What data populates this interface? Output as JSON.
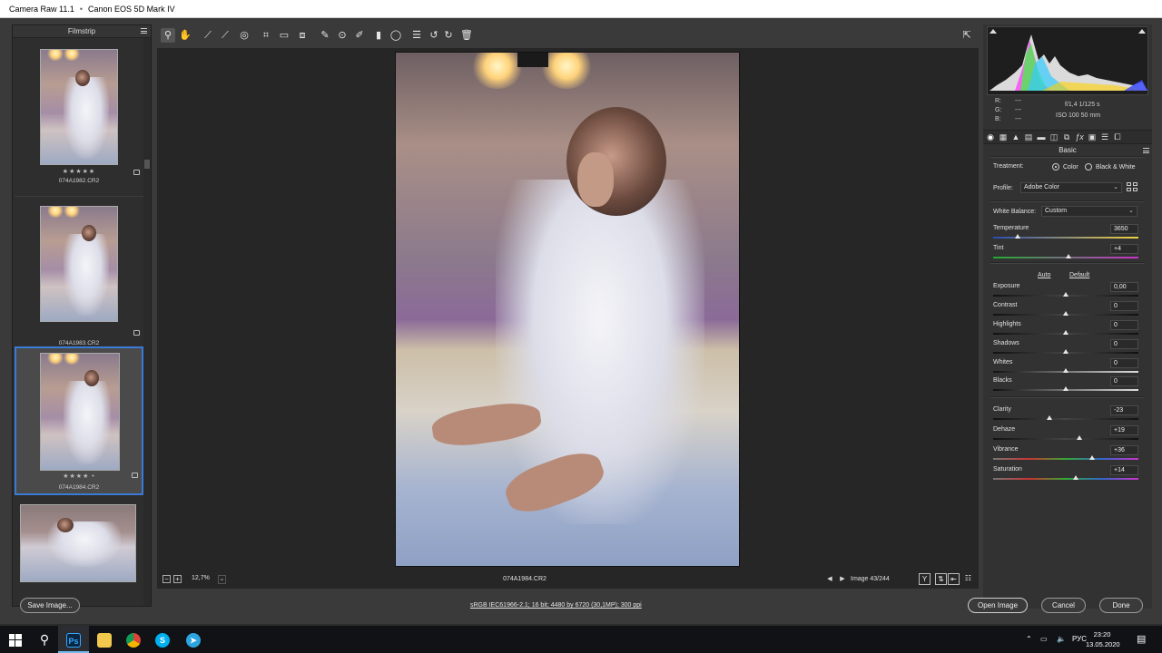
{
  "window": {
    "app_title": "Camera Raw 11.1",
    "camera": "Canon EOS 5D Mark IV"
  },
  "filmstrip": {
    "title": "Filmstrip",
    "items": [
      {
        "filename": "074A1982.CR2",
        "stars": "★★★★★"
      },
      {
        "filename": "074A1983.CR2",
        "stars": ""
      },
      {
        "filename": "074A1984.CR2",
        "stars": "★★★★ •"
      },
      {
        "filename": "",
        "stars": ""
      }
    ]
  },
  "toolbar": {
    "tools": [
      "zoom-tool-icon",
      "hand-tool-icon",
      "white-balance-tool-icon",
      "color-sampler-tool-icon",
      "targeted-adjustment-tool-icon",
      "crop-tool-icon",
      "straighten-tool-icon",
      "transform-tool-icon",
      "spot-removal-tool-icon",
      "red-eye-tool-icon",
      "adjustment-brush-icon",
      "graduated-filter-icon",
      "radial-filter-icon",
      "preferences-icon",
      "rotate-ccw-icon",
      "rotate-cw-icon",
      "trash-icon"
    ]
  },
  "canvas": {
    "zoom": "12,7%",
    "current_file": "074A1984.CR2",
    "image_count": "Image 43/244"
  },
  "histogram": {
    "rgb_labels": [
      "R:",
      "G:",
      "B:"
    ],
    "rgb_values": [
      "---",
      "---",
      "---"
    ],
    "aperture_shutter": "f/1,4   1/125 s",
    "iso_focal": "ISO 100   50 mm"
  },
  "basic": {
    "title": "Basic",
    "treatment_label": "Treatment:",
    "treatment_color": "Color",
    "treatment_bw": "Black & White",
    "profile_label": "Profile:",
    "profile_value": "Adobe Color",
    "wb_label": "White Balance:",
    "wb_value": "Custom",
    "auto_label": "Auto",
    "default_label": "Default",
    "sliders": {
      "temperature": {
        "label": "Temperature",
        "value": "3650",
        "pos": 0.17
      },
      "tint": {
        "label": "Tint",
        "value": "+4",
        "pos": 0.52
      },
      "exposure": {
        "label": "Exposure",
        "value": "0,00",
        "pos": 0.5
      },
      "contrast": {
        "label": "Contrast",
        "value": "0",
        "pos": 0.5
      },
      "highlights": {
        "label": "Highlights",
        "value": "0",
        "pos": 0.5
      },
      "shadows": {
        "label": "Shadows",
        "value": "0",
        "pos": 0.5
      },
      "whites": {
        "label": "Whites",
        "value": "0",
        "pos": 0.5
      },
      "blacks": {
        "label": "Blacks",
        "value": "0",
        "pos": 0.5
      },
      "clarity": {
        "label": "Clarity",
        "value": "-23",
        "pos": 0.385
      },
      "dehaze": {
        "label": "Dehaze",
        "value": "+19",
        "pos": 0.595
      },
      "vibrance": {
        "label": "Vibrance",
        "value": "+36",
        "pos": 0.68
      },
      "saturation": {
        "label": "Saturation",
        "value": "+14",
        "pos": 0.57
      }
    }
  },
  "footer": {
    "save_label": "Save Image...",
    "workflow_info": "sRGB IEC61966-2.1; 16 bit; 4480 by 6720 (30,1MP); 300 ppi",
    "open_label": "Open Image",
    "cancel_label": "Cancel",
    "done_label": "Done"
  },
  "taskbar": {
    "lang": "РУС",
    "time": "23:20",
    "date": "13.05.2020",
    "apps": [
      "photoshop",
      "file-explorer",
      "chrome",
      "skype",
      "telegram"
    ]
  }
}
